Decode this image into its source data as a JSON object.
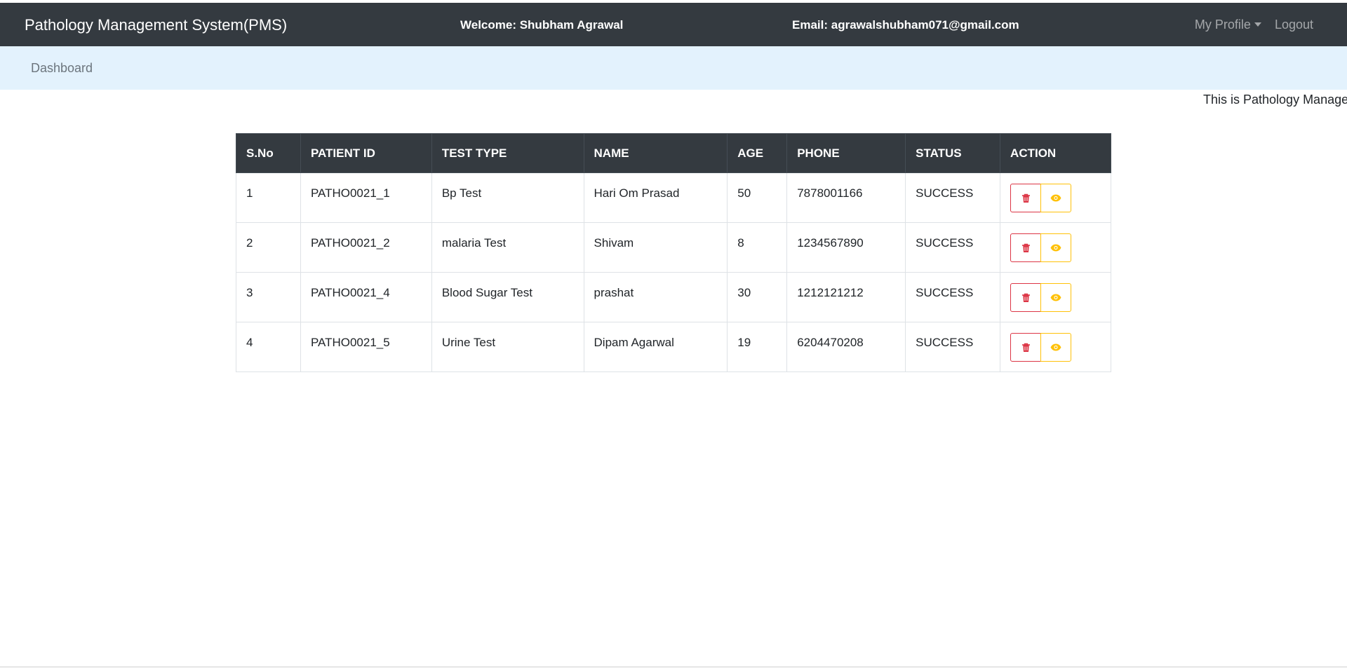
{
  "navbar": {
    "brand": "Pathology Management System(PMS)",
    "welcome": "Welcome: Shubham Agrawal",
    "email": "Email: agrawalshubham071@gmail.com",
    "profile_label": "My Profile",
    "logout_label": "Logout"
  },
  "subnav": {
    "dashboard_label": "Dashboard"
  },
  "marquee_text": "This is Pathology Manage",
  "table": {
    "headers": [
      "S.No",
      "PATIENT ID",
      "TEST TYPE",
      "NAME",
      "AGE",
      "PHONE",
      "STATUS",
      "ACTION"
    ],
    "rows": [
      {
        "sno": "1",
        "patient_id": "PATHO0021_1",
        "test_type": "Bp Test",
        "name": "Hari Om Prasad",
        "age": "50",
        "phone": "7878001166",
        "status": "SUCCESS"
      },
      {
        "sno": "2",
        "patient_id": "PATHO0021_2",
        "test_type": "malaria Test",
        "name": "Shivam",
        "age": "8",
        "phone": "1234567890",
        "status": "SUCCESS"
      },
      {
        "sno": "3",
        "patient_id": "PATHO0021_4",
        "test_type": "Blood Sugar Test",
        "name": "prashat",
        "age": "30",
        "phone": "1212121212",
        "status": "SUCCESS"
      },
      {
        "sno": "4",
        "patient_id": "PATHO0021_5",
        "test_type": "Urine Test",
        "name": "Dipam Agarwal",
        "age": "19",
        "phone": "6204470208",
        "status": "SUCCESS"
      }
    ],
    "row_actions": [
      "trash-icon",
      "eye-icon"
    ]
  },
  "colors": {
    "navbar_bg": "#343a40",
    "subnav_bg": "#e3f2fd",
    "danger": "#dc3545",
    "warning": "#ffc107"
  }
}
